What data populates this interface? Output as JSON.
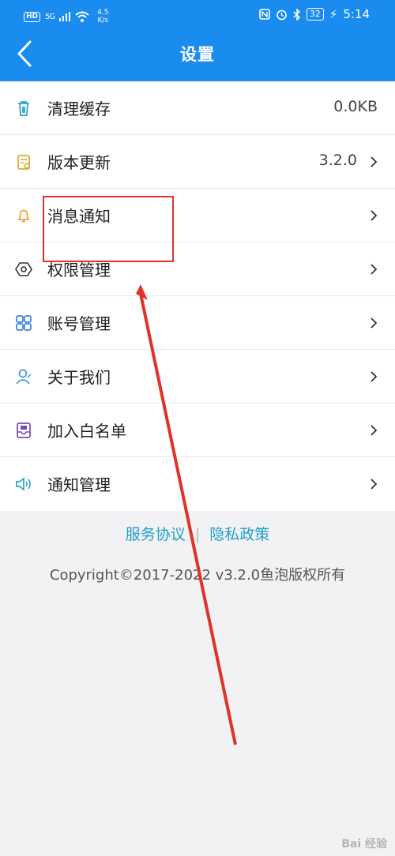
{
  "status_bar": {
    "hd_badge": "HD",
    "signal": "5G",
    "net_speed_value": "4.5",
    "net_speed_unit": "K/s",
    "battery": "32",
    "time": "5:14"
  },
  "header": {
    "title": "设置"
  },
  "settings": {
    "items": [
      {
        "label": "清理缓存",
        "value": "0.0KB",
        "icon": "trash-icon"
      },
      {
        "label": "版本更新",
        "value": "3.2.0",
        "icon": "update-calendar-icon"
      },
      {
        "label": "消息通知",
        "value": "",
        "icon": "bell-icon"
      },
      {
        "label": "权限管理",
        "value": "",
        "icon": "hexagon-icon"
      },
      {
        "label": "账号管理",
        "value": "",
        "icon": "grid-icon"
      },
      {
        "label": "关于我们",
        "value": "",
        "icon": "person-icon"
      },
      {
        "label": "加入白名单",
        "value": "",
        "icon": "inbox-icon"
      },
      {
        "label": "通知管理",
        "value": "",
        "icon": "speaker-icon"
      }
    ]
  },
  "footer": {
    "service_agreement": "服务协议",
    "divider": "|",
    "privacy_policy": "隐私政策",
    "copyright": "Copyright©2017-2022  v3.2.0鱼泡版权所有"
  },
  "watermark": "Bai 经验",
  "colors": {
    "header_bg": "#1a8cf0",
    "link": "#1fa0c8",
    "annotation": "#e0322b"
  }
}
